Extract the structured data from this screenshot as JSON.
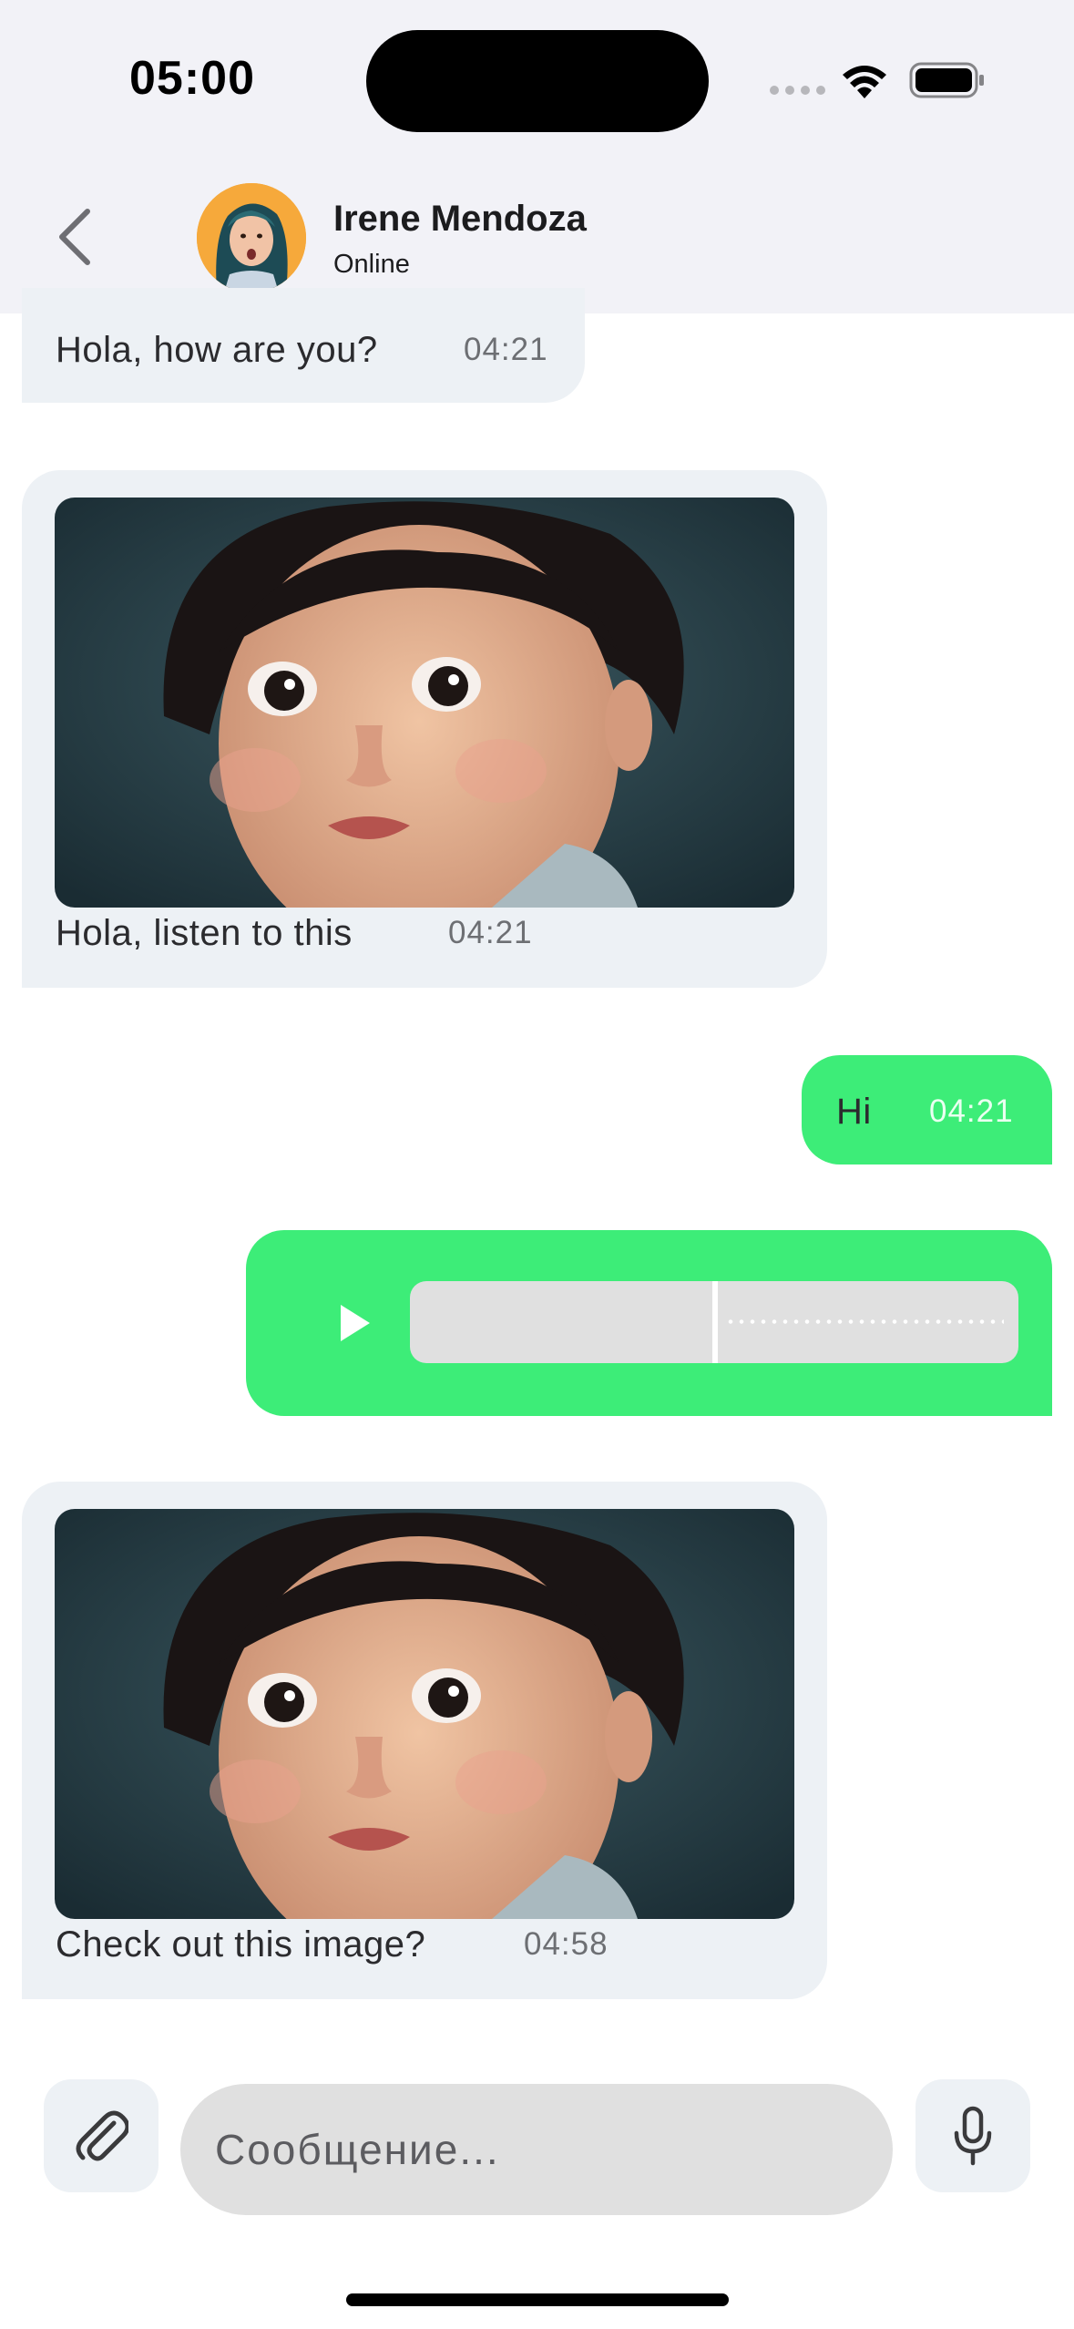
{
  "status_bar": {
    "time": "05:00"
  },
  "header": {
    "contact_name": "Irene Mendoza",
    "contact_status": "Online",
    "back_icon": "chevron-left-icon",
    "avatar_icon": "avatar"
  },
  "messages": [
    {
      "direction": "incoming",
      "type": "text",
      "text": "Hola, how are you?",
      "time": "04:21"
    },
    {
      "direction": "incoming",
      "type": "image",
      "caption": "Hola, listen to this",
      "time": "04:21"
    },
    {
      "direction": "outgoing",
      "type": "text",
      "text": "Hi",
      "time": "04:21"
    },
    {
      "direction": "outgoing",
      "type": "voice",
      "play_icon": "play-icon",
      "progress": 0.5
    },
    {
      "direction": "incoming",
      "type": "image",
      "caption": "Check out this image?",
      "time": "04:58"
    }
  ],
  "composer": {
    "placeholder": "Сообщение...",
    "attach_icon": "paperclip-icon",
    "mic_icon": "microphone-icon"
  },
  "colors": {
    "incoming_bubble": "#edf1f5",
    "outgoing_bubble": "#3ded78",
    "header_bg": "#f2f2f7",
    "input_bg": "#e0e0e0"
  }
}
